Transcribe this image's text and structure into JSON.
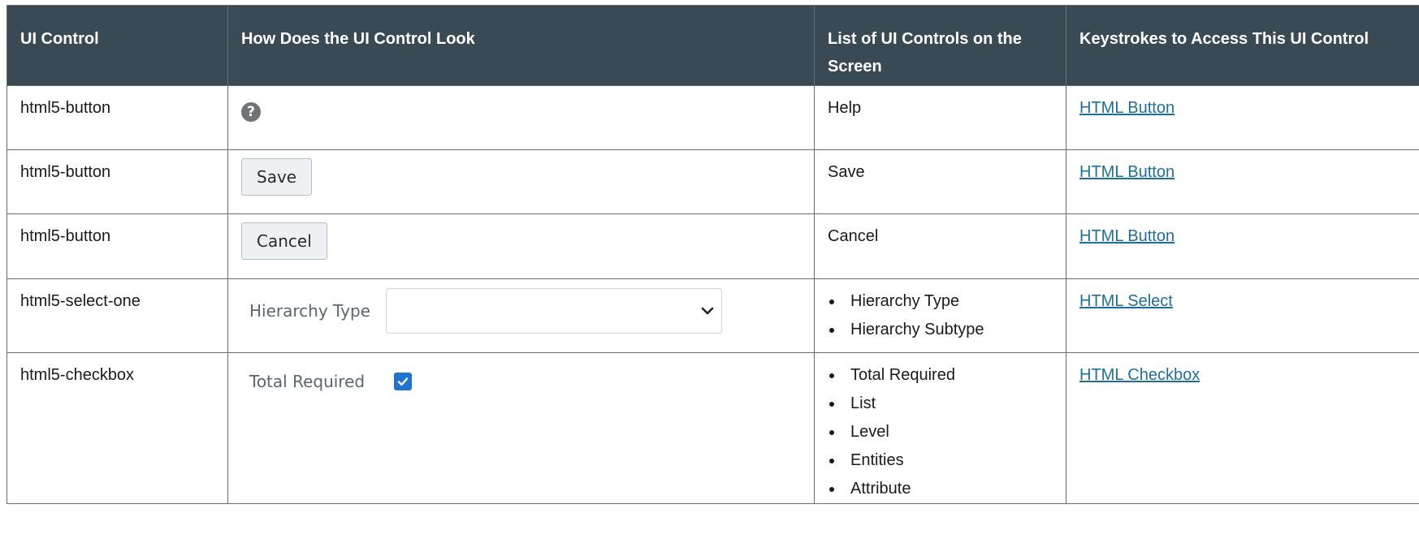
{
  "table": {
    "headers": [
      "UI Control",
      "How Does the UI Control Look",
      "List of UI Controls on the Screen",
      "Keystrokes to Access This UI Control"
    ],
    "rows": [
      {
        "control": "html5-button",
        "look": {
          "kind": "help-icon",
          "glyph": "?"
        },
        "controls_list": [
          "Help"
        ],
        "keystroke_link": "HTML Button"
      },
      {
        "control": "html5-button",
        "look": {
          "kind": "button",
          "label": "Save"
        },
        "controls_list": [
          "Save"
        ],
        "keystroke_link": "HTML Button"
      },
      {
        "control": "html5-button",
        "look": {
          "kind": "button",
          "label": "Cancel"
        },
        "controls_list": [
          "Cancel"
        ],
        "keystroke_link": "HTML Button"
      },
      {
        "control": "html5-select-one",
        "look": {
          "kind": "select",
          "label": "Hierarchy Type",
          "value": ""
        },
        "controls_list": [
          "Hierarchy Type",
          "Hierarchy Subtype"
        ],
        "keystroke_link": "HTML Select"
      },
      {
        "control": "html5-checkbox",
        "look": {
          "kind": "checkbox",
          "label": "Total Required",
          "checked": true
        },
        "controls_list": [
          "Total Required",
          "List",
          "Level",
          "Entities",
          "Attribute"
        ],
        "keystroke_link": "HTML Checkbox"
      }
    ]
  },
  "colors": {
    "header_bg": "#3a4a54",
    "link": "#1f6f9b",
    "checkbox": "#1f73d1"
  }
}
